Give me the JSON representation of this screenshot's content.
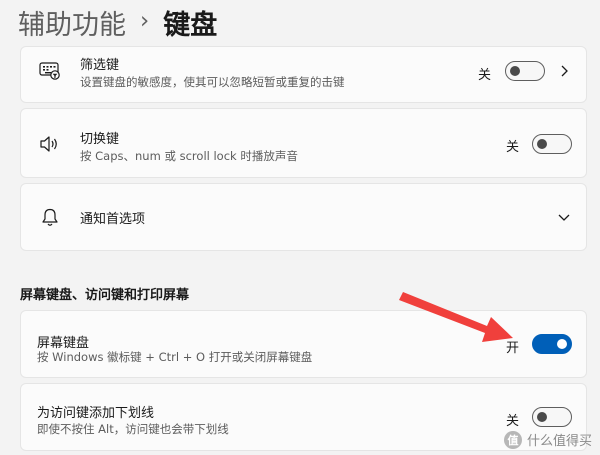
{
  "breadcrumb": {
    "parent": "辅助功能",
    "separator": "›",
    "current": "键盘"
  },
  "filter_keys": {
    "title": "筛选键",
    "description": "设置键盘的敏感度，使其可以忽略短暂或重复的击键",
    "state": "关",
    "on": false,
    "icon": "keyboard-filter-icon"
  },
  "toggle_keys": {
    "title": "切换键",
    "description": "按 Caps、num 或 scroll lock 时播放声音",
    "state": "关",
    "on": false,
    "icon": "speaker-icon"
  },
  "notification_prefs": {
    "title": "通知首选项",
    "icon": "bell-icon"
  },
  "section": {
    "title": "屏幕键盘、访问键和打印屏幕"
  },
  "onscreen_keyboard": {
    "title": "屏幕键盘",
    "description": "按 Windows 徽标键 + Ctrl + O 打开或关闭屏幕键盘",
    "state": "开",
    "on": true
  },
  "underline_access_keys": {
    "title": "为访问键添加下划线",
    "description": "即使不按住 Alt，访问键也会带下划线",
    "state": "关",
    "on": false
  },
  "annotation": {
    "color": "#f0403c"
  },
  "watermark": {
    "badge": "值",
    "text": "什么值得买"
  }
}
